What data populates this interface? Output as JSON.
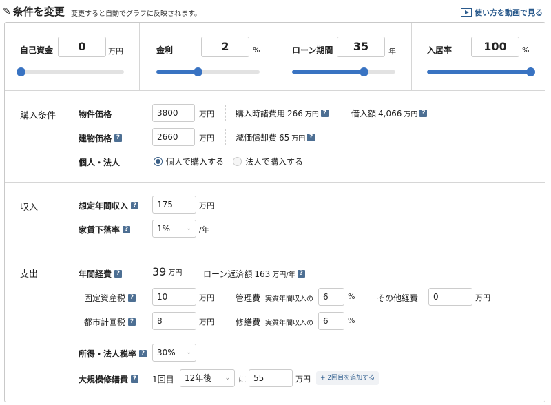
{
  "header": {
    "title": "条件を変更",
    "description": "変更すると自動でグラフに反映されます。",
    "video_link": "使い方を動画で見る"
  },
  "sliders": [
    {
      "label": "自己資金",
      "value": "0",
      "unit": "万円",
      "level_percent": 0
    },
    {
      "label": "金利",
      "value": "2",
      "unit": "%",
      "level_percent": 40
    },
    {
      "label": "ローン期間",
      "value": "35",
      "unit": "年",
      "level_percent": 69
    },
    {
      "label": "入居率",
      "value": "100",
      "unit": "%",
      "level_percent": 100
    }
  ],
  "purchase": {
    "title": "購入条件",
    "property_price_label": "物件価格",
    "property_price": "3800",
    "property_price_unit": "万円",
    "misc_cost_label": "購入時諸費用",
    "misc_cost_value": "266",
    "misc_cost_unit": "万円",
    "loan_label": "借入額",
    "loan_value": "4,066",
    "loan_unit": "万円",
    "building_price_label": "建物価格",
    "building_price": "2660",
    "building_price_unit": "万円",
    "depreciation_label": "減価償却費",
    "depreciation_value": "65",
    "depreciation_unit": "万円",
    "type_label": "個人・法人",
    "option_individual": "個人で購入する",
    "option_corporate": "法人で購入する"
  },
  "income": {
    "title": "収入",
    "annual_income_label": "想定年間収入",
    "annual_income": "175",
    "annual_income_unit": "万円",
    "rent_decline_label": "家賃下落率",
    "rent_decline": "1%",
    "rent_decline_unit": "/年"
  },
  "expense": {
    "title": "支出",
    "annual_cost_label": "年間経費",
    "annual_cost_value": "39",
    "annual_cost_unit": "万円",
    "loan_repay_label": "ローン返済額",
    "loan_repay_value": "163",
    "loan_repay_unit": "万円/年",
    "property_tax_label": "固定資産税",
    "property_tax": "10",
    "property_tax_unit": "万円",
    "mgmt_label": "管理費",
    "mgmt_prefix": "実質年間収入の",
    "mgmt_value": "6",
    "mgmt_unit": "%",
    "other_label": "その他経費",
    "other_value": "0",
    "other_unit": "万円",
    "city_tax_label": "都市計画税",
    "city_tax": "8",
    "city_tax_unit": "万円",
    "repair_label": "修繕費",
    "repair_prefix": "実質年間収入の",
    "repair_value": "6",
    "repair_unit": "%",
    "income_tax_label": "所得・法人税率",
    "income_tax": "30%",
    "major_repair_label": "大規模修繕費",
    "major_repair_count": "1回目",
    "major_repair_year": "12年後",
    "major_repair_ni": "に",
    "major_repair_cost": "55",
    "major_repair_unit": "万円",
    "add_button": "+ 2回目を追加する"
  },
  "help_glyph": "?"
}
